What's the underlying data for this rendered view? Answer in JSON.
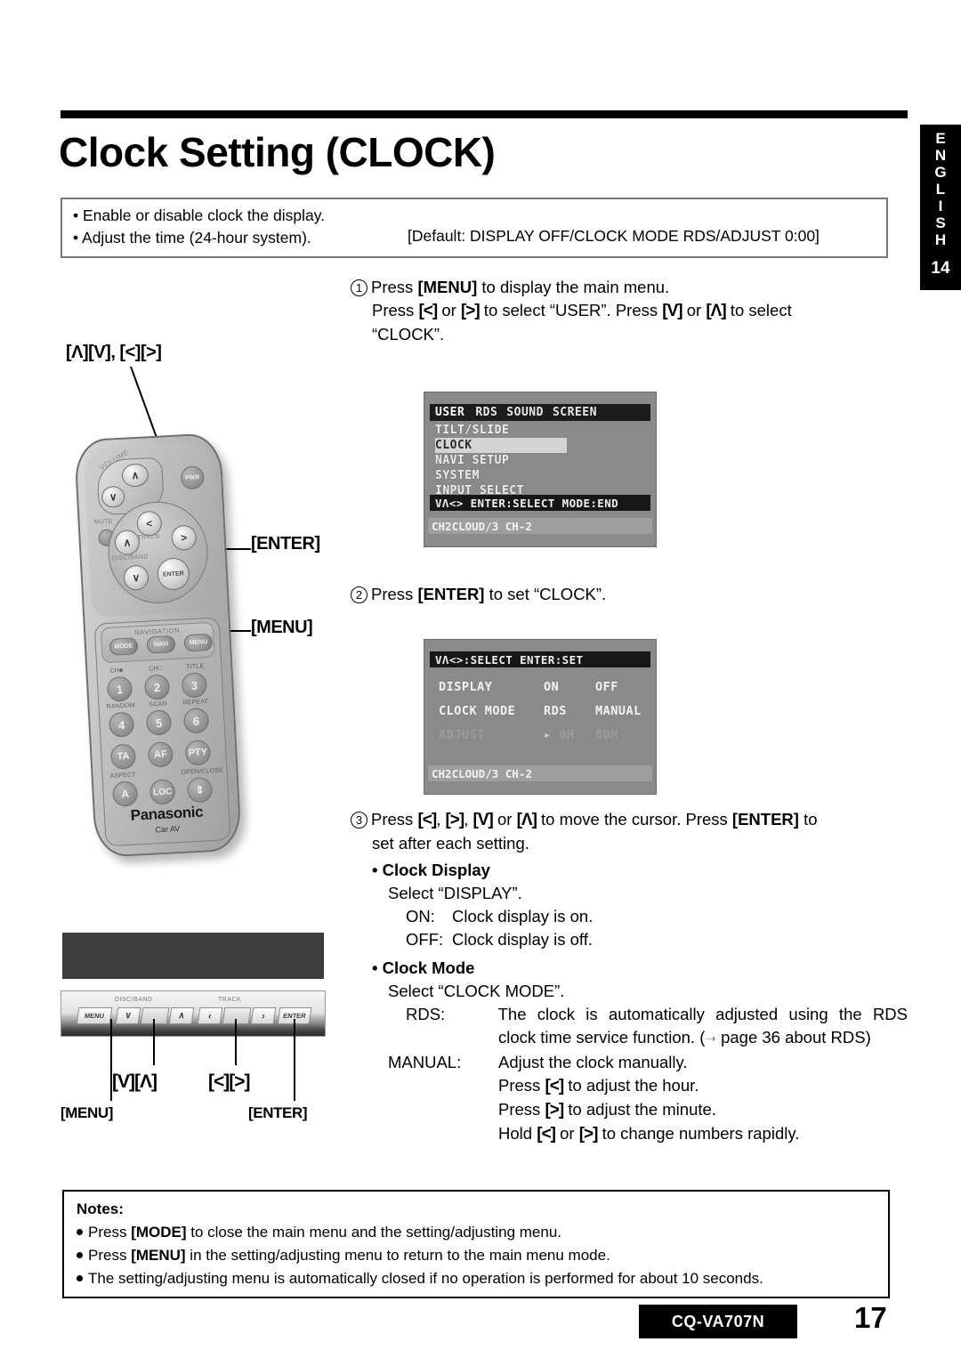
{
  "title": "Clock Setting (CLOCK)",
  "lang_tab": {
    "letters": [
      "E",
      "N",
      "G",
      "L",
      "I",
      "S",
      "H"
    ],
    "number": "14"
  },
  "summary": {
    "bullets": [
      "• Enable or disable clock the display.",
      "• Adjust the time (24-hour system)."
    ],
    "default": "[Default: DISPLAY OFF/CLOCK MODE RDS/ADJUST 0:00]"
  },
  "steps": {
    "one": {
      "num": "1",
      "line1_a": "Press ",
      "line1_key": "[MENU]",
      "line1_b": " to display the main menu.",
      "line2_a": "Press ",
      "line2_k1": "[<]",
      "line2_b": " or ",
      "line2_k2": "[>]",
      "line2_c": " to select “USER”. Press ",
      "line2_k3": "[V]",
      "line2_d": " or ",
      "line2_k4": "[Λ]",
      "line2_e": " to select",
      "line3": "“CLOCK”."
    },
    "two": {
      "num": "2",
      "a": "Press ",
      "key": "[ENTER]",
      "b": " to set “CLOCK”."
    },
    "three": {
      "num": "3",
      "a": "Press ",
      "k1": "[<]",
      "b": ", ",
      "k2": "[>]",
      "c": ", ",
      "k3": "[V]",
      "d": " or ",
      "k4": "[Λ]",
      "e": " to move the cursor. Press ",
      "key_enter": "[ENTER]",
      "f": " to",
      "line2": "set after each setting."
    }
  },
  "clock_display": {
    "heading": "• Clock Display",
    "select": "Select “DISPLAY”.",
    "on_label": "ON:",
    "on_text": "Clock display is on.",
    "off_label": "OFF:",
    "off_text": "Clock display is off."
  },
  "clock_mode": {
    "heading": "• Clock Mode",
    "select": "Select “CLOCK MODE”.",
    "rds_label": "RDS:",
    "rds_text_1": "The clock is automatically adjusted using the RDS",
    "rds_text_2a": "clock time service function. (",
    "rds_text_2b": " page 36 about RDS)",
    "manual_label": "MANUAL:",
    "manual_text": "Adjust the clock manually.",
    "hour_a": "Press ",
    "hour_k": "[<]",
    "hour_b": " to adjust the hour.",
    "min_a": "Press ",
    "min_k": "[>]",
    "min_b": " to adjust the minute.",
    "hold_a": "Hold ",
    "hold_k1": "[<]",
    "hold_b": " or ",
    "hold_k2": "[>]",
    "hold_c": " to change numbers rapidly."
  },
  "screen_main": {
    "tabs": [
      "USER",
      "RDS",
      "SOUND",
      "SCREEN"
    ],
    "selected_tab": "USER",
    "items": [
      "TILT/SLIDE",
      "CLOCK",
      "NAVI SETUP",
      "SYSTEM",
      "INPUT SELECT"
    ],
    "highlighted_item": "CLOCK",
    "guide": "VΛ<> ENTER:SELECT  MODE:END",
    "status": "CH2CLOUD/3 CH-2"
  },
  "screen_set": {
    "guide": "VΛ<>:SELECT   ENTER:SET",
    "rows": [
      {
        "label": "DISPLAY",
        "v1": "ON",
        "v2": "OFF",
        "dim": false
      },
      {
        "label": "CLOCK MODE",
        "v1": "RDS",
        "v2": "MANUAL",
        "dim": false
      },
      {
        "label": "ADJUST",
        "v1": "0H",
        "v2": "00M",
        "dim": true
      }
    ],
    "status": "CH2CLOUD/3 CH-2"
  },
  "remote": {
    "callout_updown": "[Λ][V], [<][>]",
    "callout_enter": "[ENTER]",
    "callout_menu": "[MENU]",
    "volume_label": "VOLUME",
    "pwr": "PWR",
    "mute": "MUTE",
    "track": "TRACK",
    "disc_band": "DISC/BAND",
    "enter": "ENTER",
    "navigation": "NAVIGATION",
    "nav_buttons": [
      "MODE",
      "NAVI",
      "MENU"
    ],
    "row1_labels": [
      "CH■",
      "CH□",
      "TITLE"
    ],
    "row1_keys": [
      "1",
      "2",
      "3"
    ],
    "row2_labels": [
      "RANDOM",
      "SCAN",
      "REPEAT"
    ],
    "row2_keys": [
      "4",
      "5",
      "6"
    ],
    "row3_keys": [
      "TA",
      "AF",
      "PTY"
    ],
    "row4_labels": [
      "ASPECT",
      "",
      "OPEN/CLOSE"
    ],
    "row4_keys": [
      "A",
      "LOC",
      "⇕"
    ],
    "brand": "Panasonic",
    "brand_sub": "Car AV"
  },
  "unit": {
    "labels": {
      "disc_band": "DISC/BAND",
      "track": "TRACK"
    },
    "keys": {
      "menu": "MENU",
      "down": "∨",
      "up": "∧",
      "left": "‹",
      "right": "›",
      "enter": "ENTER"
    },
    "caption_updown": "[V][Λ]",
    "caption_leftright": "[<][>]",
    "label_menu": "[MENU]",
    "label_enter": "[ENTER]"
  },
  "notes": {
    "title": "Notes:",
    "items": [
      {
        "a": "Press ",
        "key": "[MODE]",
        "b": " to close the main menu and the setting/adjusting menu."
      },
      {
        "a": "Press ",
        "key": "[MENU]",
        "b": " in the setting/adjusting menu to return to the main menu mode."
      },
      {
        "a": "The setting/adjusting menu is automatically closed if no operation is performed for about 10 seconds.",
        "key": "",
        "b": ""
      }
    ]
  },
  "footer": {
    "model": "CQ-VA707N",
    "page": "17"
  }
}
